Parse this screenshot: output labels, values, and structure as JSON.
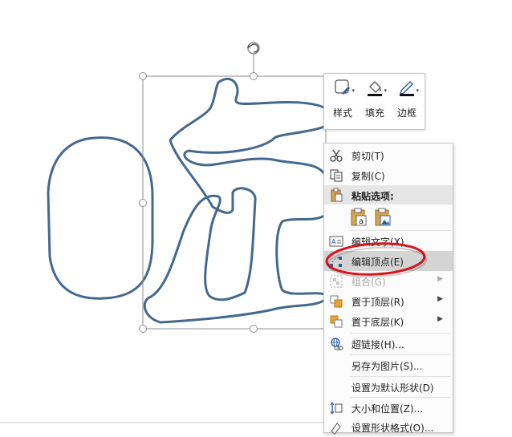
{
  "toolbar": {
    "style_label": "样式",
    "fill_label": "填充",
    "border_label": "边框"
  },
  "context_menu": {
    "cut": "剪切(T)",
    "copy": "复制(C)",
    "paste_options": "粘贴选项:",
    "edit_text": "编辑文字(X)",
    "edit_points": "编辑顶点(E)",
    "group": "组合(G)",
    "bring_to_front": "置于顶层(R)",
    "send_to_back": "置于底层(K)",
    "hyperlink": "超链接(H)...",
    "save_as_picture": "另存为图片(S)...",
    "set_default_shape": "设置为默认形状(D)",
    "size_and_position": "大小和位置(Z)...",
    "format_shape": "设置形状格式(O)..."
  },
  "colors": {
    "shape_stroke": "#44698f",
    "highlight_ellipse": "#d9141c",
    "menu_highlight": "#d4d4d4"
  },
  "icons": {
    "rotate_handle": "rotate-icon",
    "style": "shape-style-icon",
    "fill": "paint-bucket-icon",
    "border": "pen-outline-icon",
    "cut": "scissors-icon",
    "copy": "copy-icon",
    "paste": "clipboard-icon",
    "edit_text": "edit-text-icon",
    "edit_points": "edit-points-icon",
    "group": "group-icon",
    "bring_to_front": "bring-to-front-icon",
    "send_to_back": "send-to-back-icon",
    "hyperlink": "hyperlink-icon",
    "size_position": "size-position-icon",
    "format_shape": "format-shape-icon"
  }
}
